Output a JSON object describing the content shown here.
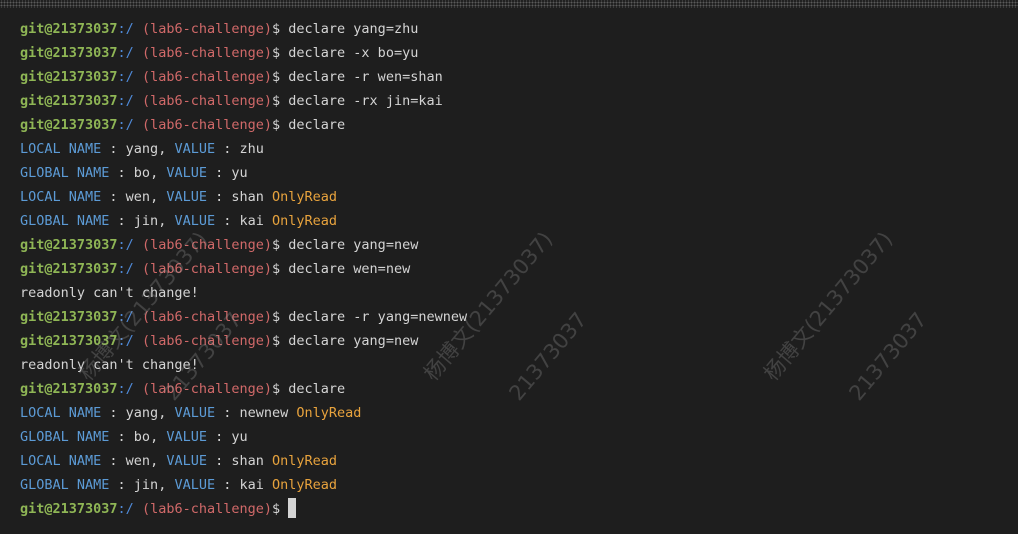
{
  "prompt": {
    "user": "git@21373037",
    "path": ":/",
    "branch": "(lab6-challenge)",
    "symbol": "$"
  },
  "lines": [
    {
      "type": "cmd",
      "text": "declare yang=zhu"
    },
    {
      "type": "cmd",
      "text": "declare -x bo=yu"
    },
    {
      "type": "cmd",
      "text": "declare -r wen=shan"
    },
    {
      "type": "cmd",
      "text": "declare -rx jin=kai"
    },
    {
      "type": "cmd",
      "text": "declare"
    },
    {
      "type": "var",
      "scope": "LOCAL NAME",
      "name": "yang",
      "value": "zhu",
      "flag": ""
    },
    {
      "type": "var",
      "scope": "GLOBAL NAME",
      "name": "bo",
      "value": "yu",
      "flag": ""
    },
    {
      "type": "var",
      "scope": "LOCAL NAME",
      "name": "wen",
      "value": "shan",
      "flag": "OnlyRead"
    },
    {
      "type": "var",
      "scope": "GLOBAL NAME",
      "name": "jin",
      "value": "kai",
      "flag": "OnlyRead"
    },
    {
      "type": "cmd",
      "text": "declare yang=new"
    },
    {
      "type": "cmd",
      "text": "declare wen=new"
    },
    {
      "type": "out",
      "text": "readonly can't change!"
    },
    {
      "type": "cmd",
      "text": "declare -r yang=newnew"
    },
    {
      "type": "cmd",
      "text": "declare yang=new"
    },
    {
      "type": "out",
      "text": "readonly can't change!"
    },
    {
      "type": "cmd",
      "text": "declare"
    },
    {
      "type": "var",
      "scope": "LOCAL NAME",
      "name": "yang",
      "value": "newnew",
      "flag": "OnlyRead"
    },
    {
      "type": "var",
      "scope": "GLOBAL NAME",
      "name": "bo",
      "value": "yu",
      "flag": ""
    },
    {
      "type": "var",
      "scope": "LOCAL NAME",
      "name": "wen",
      "value": "shan",
      "flag": "OnlyRead"
    },
    {
      "type": "var",
      "scope": "GLOBAL NAME",
      "name": "jin",
      "value": "kai",
      "flag": "OnlyRead"
    },
    {
      "type": "cmd",
      "text": ""
    }
  ],
  "var_labels": {
    "value_label": "VALUE",
    "sep": " : ",
    "comma": ", "
  },
  "watermark": {
    "name": "杨博文(21373037)",
    "id": "21373037"
  },
  "colors": {
    "background": "#1e1e1e",
    "user": "#8fb655",
    "path": "#4f8ad8",
    "branch": "#d16969",
    "keyword": "#5c9bd6",
    "readonly": "#e8a33d",
    "text": "#d4d4d4"
  }
}
